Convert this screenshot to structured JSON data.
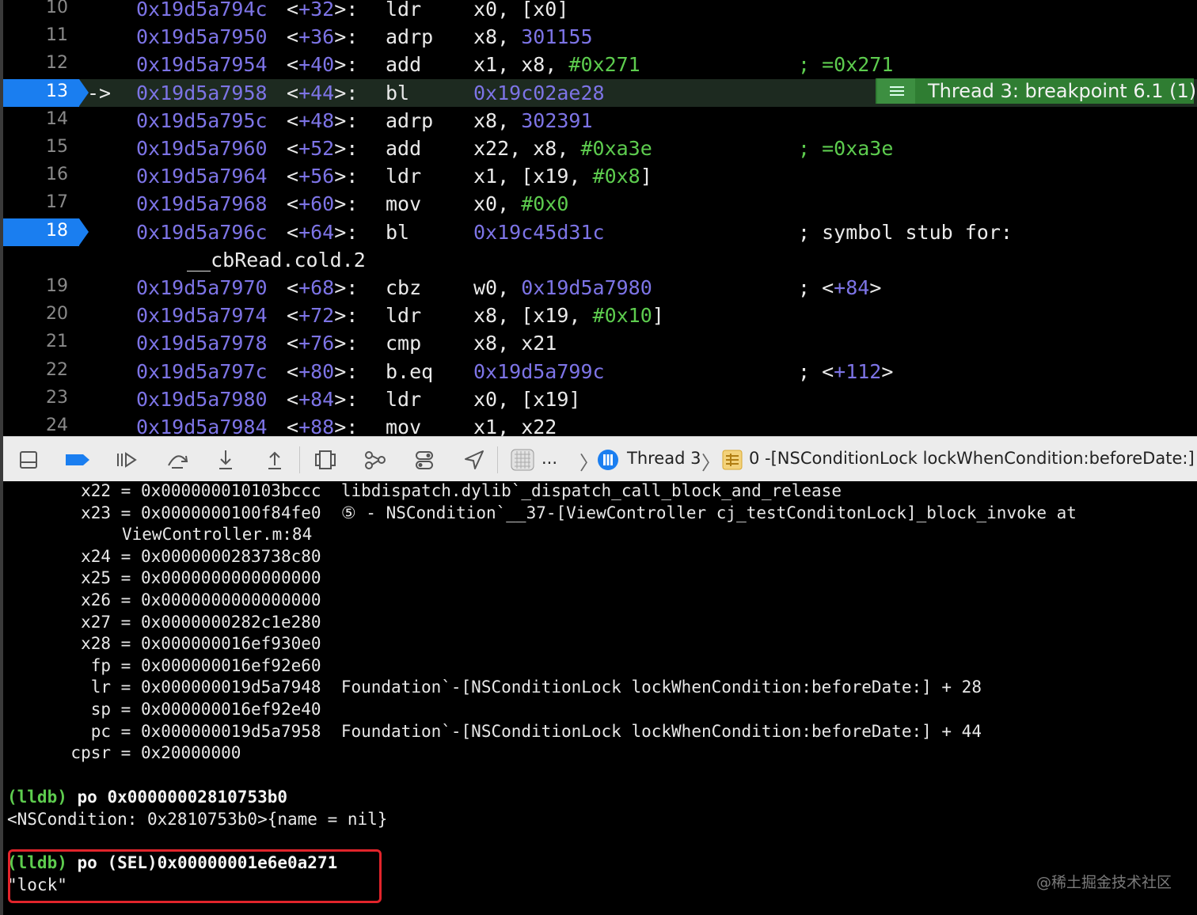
{
  "disassembly": {
    "rows": [
      {
        "line": "10",
        "arrow": "",
        "addr": "0x19d5a794c",
        "off_pre": "<",
        "off_num": "+32",
        "off_post": ">:",
        "mn": "ldr",
        "ops": [
          {
            "t": "x0, [x0]",
            "c": "plain"
          }
        ],
        "comment": []
      },
      {
        "line": "11",
        "arrow": "",
        "addr": "0x19d5a7950",
        "off_pre": "<",
        "off_num": "+36",
        "off_post": ">:",
        "mn": "adrp",
        "ops": [
          {
            "t": "x8, ",
            "c": "plain"
          },
          {
            "t": "301155",
            "c": "num"
          }
        ],
        "comment": []
      },
      {
        "line": "12",
        "arrow": "",
        "addr": "0x19d5a7954",
        "off_pre": "<",
        "off_num": "+40",
        "off_post": ">:",
        "mn": "add",
        "ops": [
          {
            "t": "x1, x8, ",
            "c": "plain"
          },
          {
            "t": "#0x271",
            "c": "imm"
          }
        ],
        "comment": [
          {
            "t": "; =0x271",
            "c": "cmn"
          }
        ]
      },
      {
        "line": "13",
        "arrow": "->",
        "addr": "0x19d5a7958",
        "off_pre": "<",
        "off_num": "+44",
        "off_post": ">:",
        "mn": "bl",
        "ops": [
          {
            "t": "0x19c02ae28",
            "c": "num"
          }
        ],
        "comment": [],
        "current": true,
        "breakpoint": true
      },
      {
        "line": "14",
        "arrow": "",
        "addr": "0x19d5a795c",
        "off_pre": "<",
        "off_num": "+48",
        "off_post": ">:",
        "mn": "adrp",
        "ops": [
          {
            "t": "x8, ",
            "c": "plain"
          },
          {
            "t": "302391",
            "c": "num"
          }
        ],
        "comment": []
      },
      {
        "line": "15",
        "arrow": "",
        "addr": "0x19d5a7960",
        "off_pre": "<",
        "off_num": "+52",
        "off_post": ">:",
        "mn": "add",
        "ops": [
          {
            "t": "x22, x8, ",
            "c": "plain"
          },
          {
            "t": "#0xa3e",
            "c": "imm"
          }
        ],
        "comment": [
          {
            "t": "; =0xa3e",
            "c": "cmn"
          }
        ]
      },
      {
        "line": "16",
        "arrow": "",
        "addr": "0x19d5a7964",
        "off_pre": "<",
        "off_num": "+56",
        "off_post": ">:",
        "mn": "ldr",
        "ops": [
          {
            "t": "x1, [x19, ",
            "c": "plain"
          },
          {
            "t": "#0x8",
            "c": "imm"
          },
          {
            "t": "]",
            "c": "plain"
          }
        ],
        "comment": []
      },
      {
        "line": "17",
        "arrow": "",
        "addr": "0x19d5a7968",
        "off_pre": "<",
        "off_num": "+60",
        "off_post": ">:",
        "mn": "mov",
        "ops": [
          {
            "t": "x0, ",
            "c": "plain"
          },
          {
            "t": "#0x0",
            "c": "imm"
          }
        ],
        "comment": []
      },
      {
        "line": "18",
        "arrow": "",
        "addr": "0x19d5a796c",
        "off_pre": "<",
        "off_num": "+64",
        "off_post": ">:",
        "mn": "bl",
        "ops": [
          {
            "t": "0x19c45d31c",
            "c": "num"
          }
        ],
        "comment": [
          {
            "t": "; symbol stub for:",
            "c": "plain"
          }
        ],
        "breakpoint": true
      },
      {
        "line": "",
        "arrow": "",
        "addr": "",
        "off_pre": "",
        "off_num": "",
        "off_post": "",
        "mn": "",
        "ops": [],
        "comment": [],
        "continuation": "__cbRead.cold.2"
      },
      {
        "line": "19",
        "arrow": "",
        "addr": "0x19d5a7970",
        "off_pre": "<",
        "off_num": "+68",
        "off_post": ">:",
        "mn": "cbz",
        "ops": [
          {
            "t": "w0, ",
            "c": "plain"
          },
          {
            "t": "0x19d5a7980",
            "c": "num"
          }
        ],
        "comment": [
          {
            "t": "; <",
            "c": "plain"
          },
          {
            "t": "+84",
            "c": "num"
          },
          {
            "t": ">",
            "c": "plain"
          }
        ]
      },
      {
        "line": "20",
        "arrow": "",
        "addr": "0x19d5a7974",
        "off_pre": "<",
        "off_num": "+72",
        "off_post": ">:",
        "mn": "ldr",
        "ops": [
          {
            "t": "x8, [x19, ",
            "c": "plain"
          },
          {
            "t": "#0x10",
            "c": "imm"
          },
          {
            "t": "]",
            "c": "plain"
          }
        ],
        "comment": []
      },
      {
        "line": "21",
        "arrow": "",
        "addr": "0x19d5a7978",
        "off_pre": "<",
        "off_num": "+76",
        "off_post": ">:",
        "mn": "cmp",
        "ops": [
          {
            "t": "x8, x21",
            "c": "plain"
          }
        ],
        "comment": []
      },
      {
        "line": "22",
        "arrow": "",
        "addr": "0x19d5a797c",
        "off_pre": "<",
        "off_num": "+80",
        "off_post": ">:",
        "mn": "b.eq",
        "ops": [
          {
            "t": "0x19d5a799c",
            "c": "num"
          }
        ],
        "comment": [
          {
            "t": "; <",
            "c": "plain"
          },
          {
            "t": "+112",
            "c": "num"
          },
          {
            "t": ">",
            "c": "plain"
          }
        ]
      },
      {
        "line": "23",
        "arrow": "",
        "addr": "0x19d5a7980",
        "off_pre": "<",
        "off_num": "+84",
        "off_post": ">:",
        "mn": "ldr",
        "ops": [
          {
            "t": "x0, [x19]",
            "c": "plain"
          }
        ],
        "comment": []
      },
      {
        "line": "24",
        "arrow": "",
        "addr": "0x19d5a7984",
        "off_pre": "<",
        "off_num": "+88",
        "off_post": ">:",
        "mn": "mov",
        "ops": [
          {
            "t": "x1, x22",
            "c": "plain"
          }
        ],
        "comment": []
      }
    ],
    "thread_badge": "Thread 3: breakpoint 6.1 (1)"
  },
  "toolbar": {
    "buttons": [
      {
        "name": "hide-debug-area-button",
        "icon": "panel-icon"
      },
      {
        "name": "breakpoints-toggle-button",
        "icon": "breakpoint-icon",
        "active": true
      },
      {
        "name": "continue-button",
        "icon": "continue-icon"
      },
      {
        "name": "step-over-button",
        "icon": "step-over-icon"
      },
      {
        "name": "step-into-button",
        "icon": "step-into-icon"
      },
      {
        "name": "step-out-button",
        "icon": "step-out-icon"
      },
      {
        "name": "view-hierarchy-button",
        "icon": "view-hierarchy-icon"
      },
      {
        "name": "memory-graph-button",
        "icon": "memory-graph-icon"
      },
      {
        "name": "environment-overrides-button",
        "icon": "environment-icon"
      },
      {
        "name": "simulate-location-button",
        "icon": "location-icon"
      }
    ],
    "app_ellipsis": "...",
    "thread_label": "Thread 3",
    "frame_label": "0 -[NSConditionLock lockWhenCondition:beforeDate:]",
    "accent": "#1a7ef0"
  },
  "console": {
    "registers": [
      {
        "name": "x22",
        "value": "0x000000010103bccc",
        "desc": "libdispatch.dylib`_dispatch_call_block_and_release"
      },
      {
        "name": "x23",
        "value": "0x0000000100f84fe0",
        "desc": "⑤ - NSCondition`__37-[ViewController cj_testConditonLock]_block_invoke at",
        "desc2": "ViewController.m:84"
      },
      {
        "name": "x24",
        "value": "0x0000000283738c80",
        "desc": ""
      },
      {
        "name": "x25",
        "value": "0x0000000000000000",
        "desc": ""
      },
      {
        "name": "x26",
        "value": "0x0000000000000000",
        "desc": ""
      },
      {
        "name": "x27",
        "value": "0x0000000282c1e280",
        "desc": ""
      },
      {
        "name": "x28",
        "value": "0x000000016ef930e0",
        "desc": ""
      },
      {
        "name": "fp",
        "value": "0x000000016ef92e60",
        "desc": ""
      },
      {
        "name": "lr",
        "value": "0x000000019d5a7948",
        "desc": "Foundation`-[NSConditionLock lockWhenCondition:beforeDate:] + 28"
      },
      {
        "name": "sp",
        "value": "0x000000016ef92e40",
        "desc": ""
      },
      {
        "name": "pc",
        "value": "0x000000019d5a7958",
        "desc": "Foundation`-[NSConditionLock lockWhenCondition:beforeDate:] + 44"
      },
      {
        "name": "cpsr",
        "value": "0x20000000",
        "desc": ""
      }
    ],
    "prompt": "(lldb)",
    "cmd1": "po 0x00000002810753b0",
    "out1": "<NSCondition: 0x2810753b0>{name = nil}",
    "cmd2": "po (SEL)0x00000001e6e0a271",
    "out2": "\"lock\"",
    "watermark": "@稀土掘金技术社区"
  }
}
